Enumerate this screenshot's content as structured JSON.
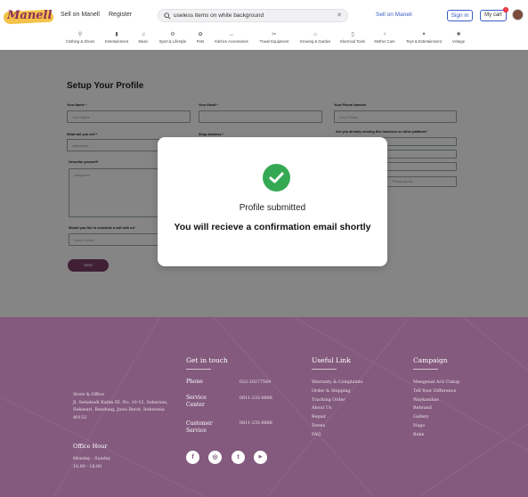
{
  "header": {
    "logo": "Manell",
    "sell_link": "Sell on Manell",
    "register_link": "Register",
    "search_value": "useless items on white background",
    "sell_link_right": "Sell on Maneli",
    "signin_label": "Sign in",
    "cart_label": "My cart",
    "cart_count": "1",
    "categories": [
      {
        "label": "Clothing & Shoes",
        "icon": "shirt-icon"
      },
      {
        "label": "Entertainment",
        "icon": "tv-icon"
      },
      {
        "label": "Music",
        "icon": "music-icon"
      },
      {
        "label": "Sport & Lifestyle",
        "icon": "sport-icon"
      },
      {
        "label": "Pets",
        "icon": "paw-icon"
      },
      {
        "label": "Kitchen Accessories",
        "icon": "kitchen-icon"
      },
      {
        "label": "Travel Equipment",
        "icon": "travel-icon"
      },
      {
        "label": "Growing & Garden",
        "icon": "garden-icon"
      },
      {
        "label": "Electrical Tools",
        "icon": "tools-icon"
      },
      {
        "label": "Mother Care",
        "icon": "stroller-icon"
      },
      {
        "label": "Toys & Entertainment",
        "icon": "toys-icon"
      },
      {
        "label": "Vintage",
        "icon": "vintage-icon"
      }
    ]
  },
  "form": {
    "title": "Setup Your Profile",
    "name_label": "Your Name *",
    "name_placeholder": "Your Name",
    "email_label": "Your Email *",
    "phone_label": "Your Phone Number",
    "phone_placeholder": "Your Phone",
    "sell_label": "What will you sell *",
    "sell_placeholder": "categories",
    "shop_label": "Shop Address *",
    "other_platform_label": "Are you already running this business on other platform*",
    "describe_label": "Describe yourself*",
    "describe_placeholder": "categories",
    "platform_placeholder": "Please specify",
    "call_label": "Would you like to schedule a call with us*",
    "call_placeholder": "Select option",
    "next_label": "Next"
  },
  "modal": {
    "title": "Profile submitted",
    "message": "You will recieve a confirmation email shortly"
  },
  "footer": {
    "address": [
      "Store & Office",
      "Jl. Setiabudi Kalim III. No. 10-12, Sukarasa,",
      "Sukasari, Bandung, Jawa Barat, Indonesia",
      "40152"
    ],
    "office_hour_title": "Office Hour",
    "office_hours": [
      "Monday - Sunday",
      "10.00 - 18.00"
    ],
    "get_in_touch": "Get in touch",
    "phone_label": "Phone",
    "phone_value": "022-20277564",
    "service_label_1": "Service",
    "service_label_2": "Center",
    "service_value": "0811-233-8888",
    "customer_label_1": "Customer",
    "customer_label_2": "Service",
    "customer_value": "0811-235-8888",
    "useful_title": "Useful Link",
    "useful_links": [
      "Warranty & Complaints",
      "Order & Shipping",
      "Tracking Order",
      "About Us",
      "Repair",
      "Terms",
      "FAQ"
    ],
    "campaign_title": "Campaign",
    "campaign_links": [
      "Mengenal Arti Cukup",
      "Tell Your Difference",
      "Waykambas",
      "Rebrand",
      "Gallery",
      "Nugo",
      "Bukn"
    ],
    "social": [
      {
        "name": "facebook-icon",
        "glyph": "f"
      },
      {
        "name": "instagram-icon",
        "glyph": "◎"
      },
      {
        "name": "twitter-icon",
        "glyph": "t"
      },
      {
        "name": "youtube-icon",
        "glyph": "▶"
      }
    ]
  }
}
